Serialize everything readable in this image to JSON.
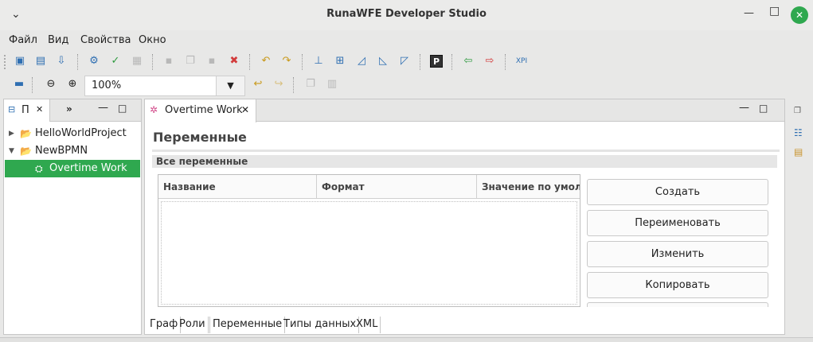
{
  "window": {
    "title": "RunaWFE Developer Studio",
    "controls": {
      "minimize": "—",
      "maximize": "□",
      "close": "✕",
      "menu": "⌄"
    }
  },
  "menubar": [
    "Файл",
    "Вид",
    "Свойства",
    "Окно"
  ],
  "toolbar2": {
    "zoom_value": "100%",
    "zoom_dropdown": "▼"
  },
  "left_panel": {
    "tab_label": "П",
    "tab_close": "✕",
    "overflow": "»",
    "minimize": "—",
    "maximize": "□",
    "tree": [
      {
        "label": "HelloWorldProject",
        "expanded": false,
        "level": 0
      },
      {
        "label": "NewBPMN",
        "expanded": true,
        "level": 0
      },
      {
        "label": "Overtime Work",
        "level": 1,
        "selected": true
      }
    ]
  },
  "editor": {
    "tab_label": "Overtime Work",
    "tab_close": "✕",
    "minimize": "—",
    "maximize": "□",
    "page_title": "Переменные",
    "section_title": "Все переменные",
    "table": {
      "columns": [
        "Название",
        "Формат",
        "Значение по умолчанию"
      ],
      "rows": []
    },
    "buttons": [
      "Создать",
      "Переименовать",
      "Изменить",
      "Копировать"
    ],
    "bottom_tabs": [
      "Граф",
      "Роли",
      "Переменные",
      "Типы данных",
      "XML"
    ],
    "active_bottom_tab": "Переменные"
  },
  "colors": {
    "accent_green": "#2fa84f",
    "selection": "#2fa84f",
    "panel_border": "#c7c7c7"
  },
  "icons": {
    "toolbar1": [
      "new-project-icon",
      "new-diagram-icon",
      "import-icon",
      "export-icon",
      "check-icon",
      "properties-icon",
      "save-icon",
      "save-as-icon",
      "save-all-icon",
      "delete-icon",
      "undo-icon",
      "redo-icon",
      "align-icon",
      "layout-icon",
      "copy-graph-icon",
      "paste-graph-icon",
      "translate-icon",
      "p-icon",
      "import-process-icon",
      "export-process-icon",
      "xpi-icon"
    ],
    "toolbar2": [
      "grip-icon",
      "zoom-out-icon",
      "zoom-in-icon",
      "undo-arrow-icon",
      "redo-arrow-icon",
      "copy-icon",
      "paste-icon"
    ]
  }
}
